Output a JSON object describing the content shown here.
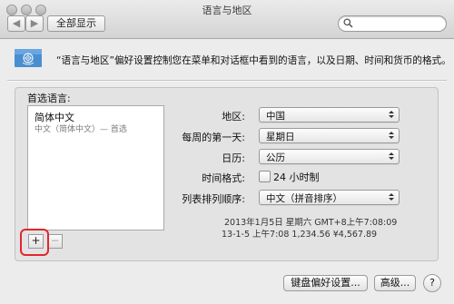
{
  "window": {
    "title": "语言与地区"
  },
  "toolbar": {
    "back_label": "◀",
    "forward_label": "▶",
    "show_all_label": "全部显示",
    "search_placeholder": ""
  },
  "description": "“语言与地区”偏好设置控制您在菜单和对话框中看到的语言，以及日期、时间和货币的格式。",
  "preferred_languages": {
    "label": "首选语言:",
    "items": [
      {
        "label": "简体中文",
        "sublabel": "中文（简体中文）— 首选"
      }
    ],
    "add_label": "+",
    "remove_label": "−"
  },
  "settings": {
    "region_label": "地区:",
    "region_value": "中国",
    "first_day_label": "每周的第一天:",
    "first_day_value": "星期日",
    "calendar_label": "日历:",
    "calendar_value": "公历",
    "time_format_label": "时间格式:",
    "time_format_option": "24 小时制",
    "time_format_checked": false,
    "list_sort_label": "列表排列顺序:",
    "list_sort_value": "中文（拼音排序）"
  },
  "samples": {
    "line1": "2013年1月5日 星期六 GMT+8上午7:08:09",
    "line2": "13-1-5 上午7:08   1,234.56   ¥4,567.89"
  },
  "buttons": {
    "keyboard_label": "键盘偏好设置...",
    "advanced_label": "高级...",
    "help_label": "?"
  },
  "colors": {
    "highlight": "#e2262e",
    "flag": "#4a8ed0"
  }
}
